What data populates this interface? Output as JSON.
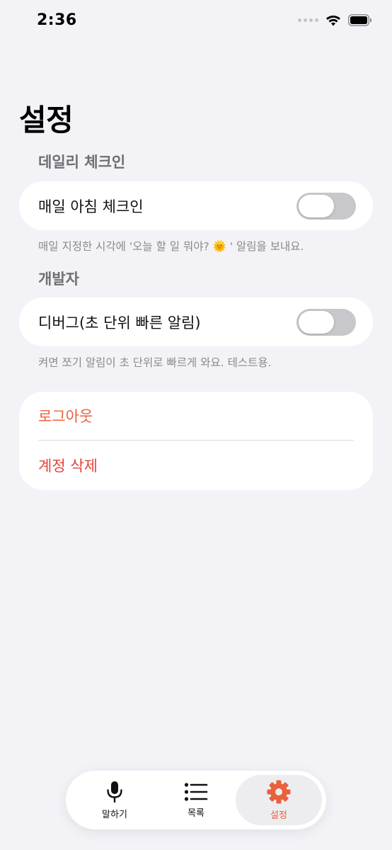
{
  "status_bar": {
    "time": "2:36"
  },
  "page": {
    "title": "설정"
  },
  "sections": {
    "daily": {
      "header": "데일리 체크인",
      "toggle_label": "매일 아침 체크인",
      "toggle_on": false,
      "footnote": "매일 지정한 시각에 '오늘 할 일 뭐야? 🌞 ' 알림을 보내요."
    },
    "developer": {
      "header": "개발자",
      "toggle_label": "디버그(초 단위 빠른 알림)",
      "toggle_on": false,
      "footnote": "켜면 쪼기 알림이 초 단위로 빠르게 와요. 테스트용."
    },
    "account": {
      "logout": "로그아웃",
      "delete_account": "계정 삭제"
    }
  },
  "tabbar": {
    "tabs": [
      {
        "label": "말하기",
        "icon": "microphone-icon",
        "active": false
      },
      {
        "label": "목록",
        "icon": "list-icon",
        "active": false
      },
      {
        "label": "설정",
        "icon": "gear-icon",
        "active": true
      }
    ]
  },
  "colors": {
    "background": "#F2F2F7",
    "accent": "#E8613C",
    "destructive": "#E4423B",
    "toggle_off": "#C7C7CC"
  }
}
